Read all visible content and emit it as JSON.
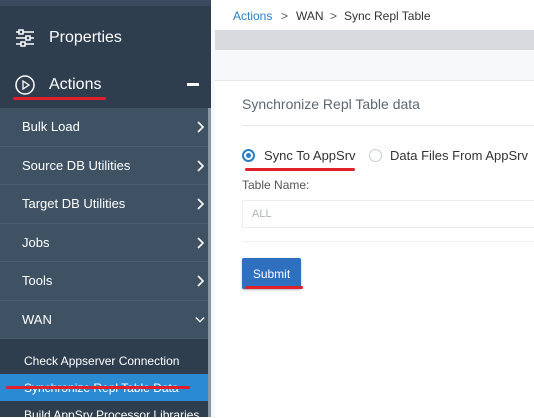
{
  "sidebar": {
    "properties_label": "Properties",
    "actions_label": "Actions",
    "items": [
      {
        "label": "Bulk Load"
      },
      {
        "label": "Source DB Utilities"
      },
      {
        "label": "Target DB Utilities"
      },
      {
        "label": "Jobs"
      },
      {
        "label": "Tools"
      },
      {
        "label": "WAN"
      }
    ],
    "wan_sub": [
      {
        "label": "Check Appserver Connection"
      },
      {
        "label": "Synchronize Repl Table Data"
      },
      {
        "label": "Build AppSrv Processor Libraries"
      }
    ]
  },
  "breadcrumb": {
    "root": "Actions",
    "sep1": ">",
    "mid": "WAN",
    "sep2": ">",
    "current": "Sync Repl Table"
  },
  "form": {
    "title": "Synchronize Repl Table data",
    "radio_1": "Sync To AppSrv",
    "radio_2": "Data Files From AppSrv",
    "selected_radio": "Sync To AppSrv",
    "table_name_label": "Table Name:",
    "table_name_value": "ALL",
    "submit_label": "Submit"
  },
  "colors": {
    "sidebar_bg": "#2f3e4f",
    "menu_item_bg": "#3f5264",
    "active_item": "#2a8bd3",
    "link": "#2a7ec4",
    "submit_bg": "#2f6fbf",
    "annotation_red": "#e0202a"
  },
  "icons": [
    "sliders-icon",
    "play-circle-icon",
    "minus-icon",
    "chevron-right-icon",
    "chevron-down-icon"
  ]
}
